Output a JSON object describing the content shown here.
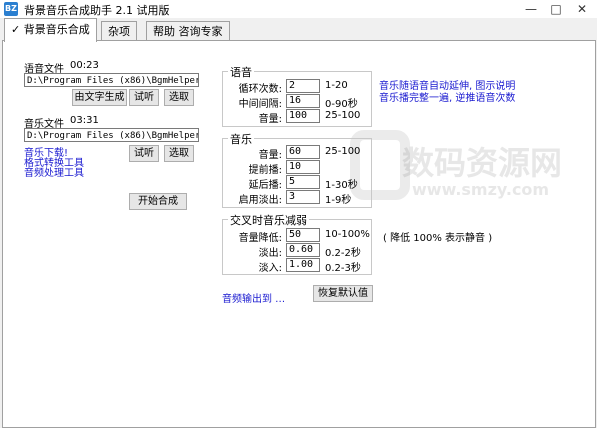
{
  "window": {
    "icon": "BZ",
    "title": "背景音乐合成助手 2.1 试用版"
  },
  "tabs": [
    "背景音乐合成",
    "杂项",
    "帮助 咨询专家"
  ],
  "voice": {
    "label": "语音文件",
    "duration": "00:23",
    "path": "D:\\Program Files (x86)\\BgmHelper\\mu",
    "gen_btn": "由文字生成",
    "play_btn": "试听",
    "pick_btn": "选取"
  },
  "music": {
    "label": "音乐文件",
    "duration": "03:31",
    "path": "D:\\Program Files (x86)\\BgmHelper\\mu",
    "play_btn": "试听",
    "pick_btn": "选取"
  },
  "links": [
    "音乐下载!",
    "格式转换工具",
    "音频处理工具"
  ],
  "start_btn": "开始合成",
  "voice_group": {
    "title": "语音",
    "rows": [
      {
        "label": "循环次数:",
        "value": "2",
        "range": "1-20"
      },
      {
        "label": "中间间隔:",
        "value": "16",
        "range": "0-90秒"
      },
      {
        "label": "音量:",
        "value": "100",
        "range": "25-100"
      }
    ]
  },
  "voice_note": [
    "音乐随语音自动延伸, 图示说明",
    "音乐播完整一遍, 逆推语音次数"
  ],
  "music_group": {
    "title": "音乐",
    "rows": [
      {
        "label": "音量:",
        "value": "60",
        "range": "25-100"
      },
      {
        "label": "提前播:",
        "value": "10",
        "range": ""
      },
      {
        "label": "延后播:",
        "value": "5",
        "range": "1-30秒"
      },
      {
        "label": "启用淡出:",
        "value": "3",
        "range": "1-9秒"
      }
    ]
  },
  "cross_group": {
    "title": "交叉时音乐减弱",
    "rows": [
      {
        "label": "音量降低:",
        "value": "50",
        "range": "10-100%"
      },
      {
        "label": "淡出:",
        "value": "0.60",
        "range": "0.2-2秒"
      },
      {
        "label": "淡入:",
        "value": "1.00",
        "range": "0.2-3秒"
      }
    ],
    "note": "( 降低 100% 表示静音 )"
  },
  "output_link": "音频输出到 …",
  "reset_btn": "恢复默认值",
  "watermark": {
    "brand": "数码资源网",
    "url": "www.smzy.com"
  },
  "colors": {
    "link": "#1a1ad0",
    "icon": "#2b7fd0"
  }
}
